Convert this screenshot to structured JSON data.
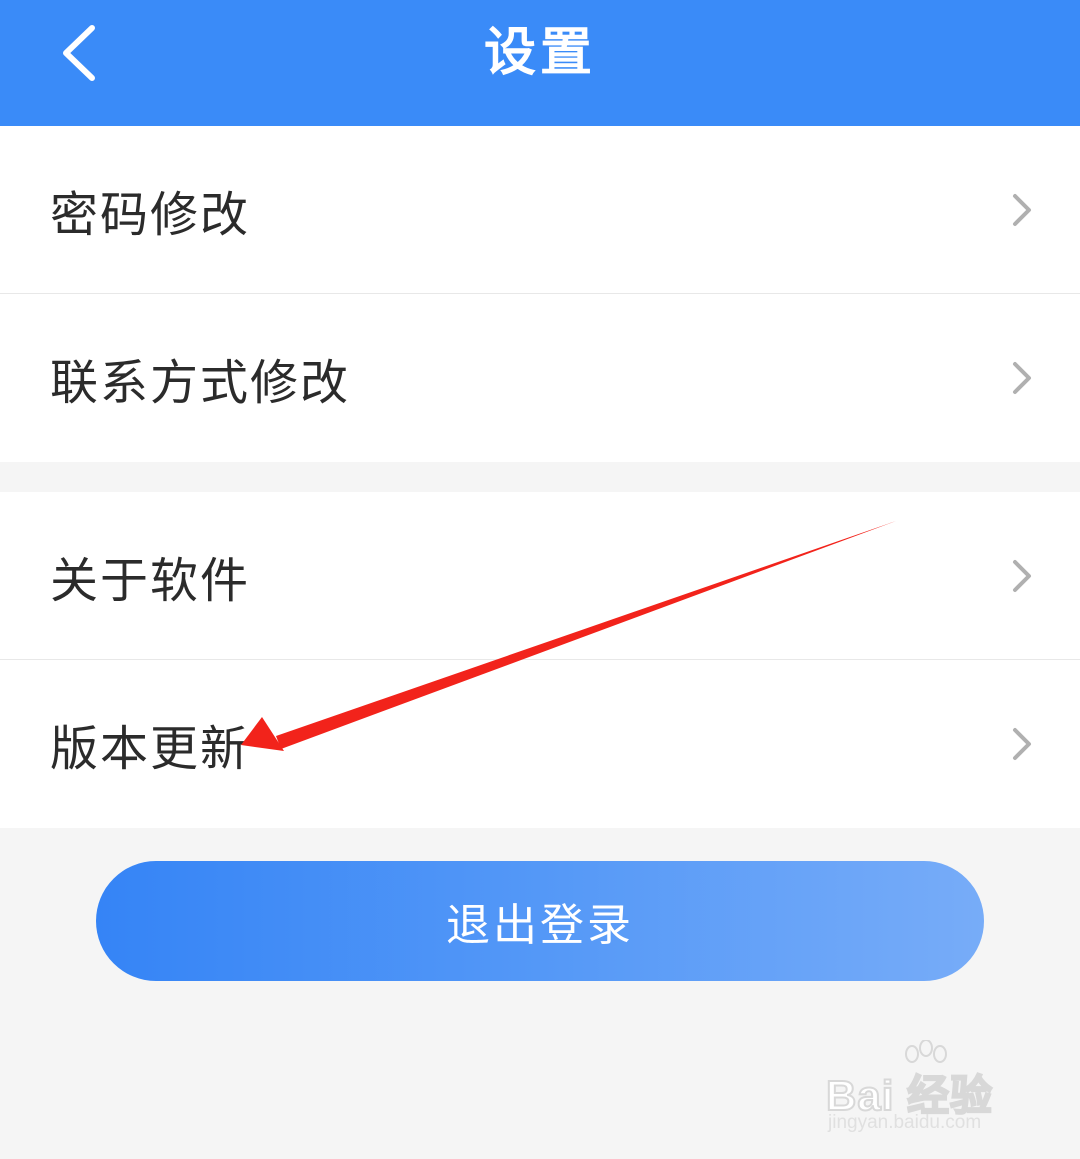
{
  "header": {
    "title": "设置",
    "back_icon": "chevron-left-icon",
    "background_color": "#3a8bf8"
  },
  "settings_group_1": [
    {
      "label": "密码修改",
      "icon": "chevron-right-icon"
    },
    {
      "label": "联系方式修改",
      "icon": "chevron-right-icon"
    }
  ],
  "settings_group_2": [
    {
      "label": "关于软件",
      "icon": "chevron-right-icon"
    },
    {
      "label": "版本更新",
      "icon": "chevron-right-icon"
    }
  ],
  "logout_button": {
    "label": "退出登录",
    "gradient_colors": [
      "#3584f6",
      "#77acf8"
    ]
  },
  "annotation": {
    "type": "red-arrow",
    "color": "#f2231b",
    "points_to": "版本更新"
  },
  "watermark": {
    "logo_text": "Bai  经验",
    "url": "jingyan.baidu.com"
  }
}
